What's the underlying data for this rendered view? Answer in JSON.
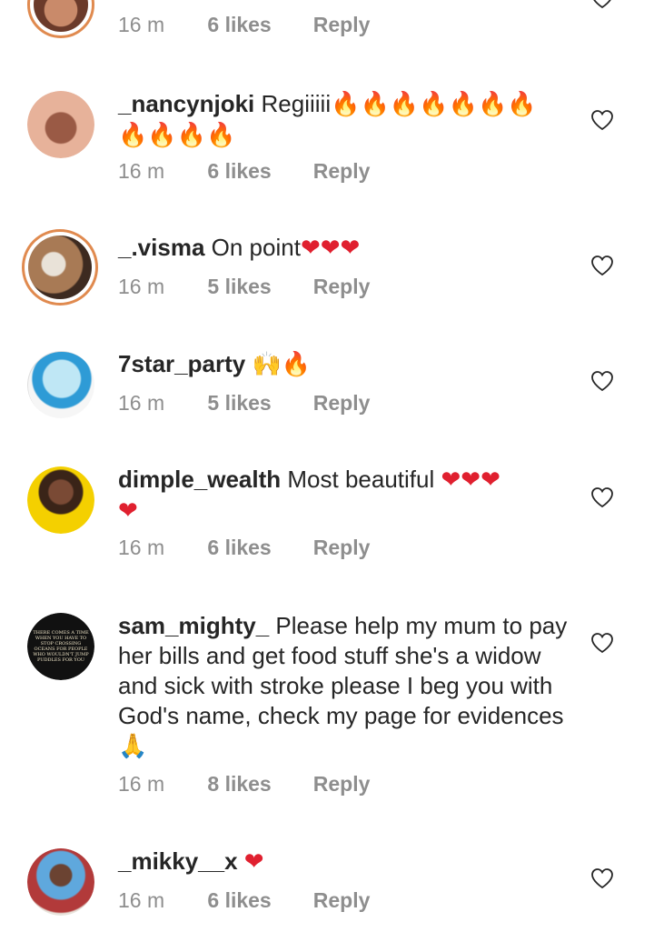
{
  "comments": [
    {
      "username": "",
      "text": "",
      "emoji": "",
      "time": "16 m",
      "likes": "6 likes",
      "reply": "Reply",
      "avatar_ring": true,
      "avatar_colors": [
        "#c98a6a",
        "#6b3a2a"
      ]
    },
    {
      "username": "_nancynjoki",
      "text": "Regiiiii",
      "emoji": "🔥🔥🔥🔥🔥🔥🔥",
      "emoji2": "🔥🔥🔥🔥",
      "time": "16 m",
      "likes": "6 likes",
      "reply": "Reply",
      "avatar_ring": false,
      "avatar_colors": [
        "#e7b29a",
        "#7a3d2c"
      ]
    },
    {
      "username": "_.visma",
      "text": "On point",
      "emoji": "❤❤❤",
      "time": "16 m",
      "likes": "5 likes",
      "reply": "Reply",
      "avatar_ring": true,
      "avatar_colors": [
        "#a87a55",
        "#3d2a20"
      ]
    },
    {
      "username": "7star_party",
      "text": "",
      "emoji": "🙌🔥",
      "time": "16 m",
      "likes": "5 likes",
      "reply": "Reply",
      "avatar_ring": false,
      "avatar_colors": [
        "#bfe7f5",
        "#2e9bd6"
      ]
    },
    {
      "username": "dimple_wealth",
      "text": "Most beautiful",
      "emoji": "❤❤❤",
      "emoji2": "❤",
      "time": "16 m",
      "likes": "6 likes",
      "reply": "Reply",
      "avatar_ring": false,
      "avatar_colors": [
        "#f4d000",
        "#3a2418"
      ]
    },
    {
      "username": "sam_mighty_",
      "text": "Please help my mum to pay her bills and get food stuff she's a widow and sick with stroke please I beg you with God's name, check my page for evidences",
      "emoji": "🙏",
      "time": "16 m",
      "likes": "8 likes",
      "reply": "Reply",
      "avatar_ring": false,
      "avatar_colors": [
        "#111111",
        "#c9a24a"
      ],
      "avatar_text": [
        "THERE COMES A TIME",
        "WHEN YOU HAVE TO",
        "STOP CROSSING",
        "OCEANS FOR PEOPLE",
        "WHO WOULDN'T JUMP",
        "PUDDLES FOR YOU"
      ]
    },
    {
      "username": "_mikky__x",
      "text": "",
      "emoji": "❤",
      "time": "16 m",
      "likes": "6 likes",
      "reply": "Reply",
      "avatar_ring": false,
      "avatar_colors": [
        "#5fa8dd",
        "#b23a3a"
      ]
    }
  ]
}
